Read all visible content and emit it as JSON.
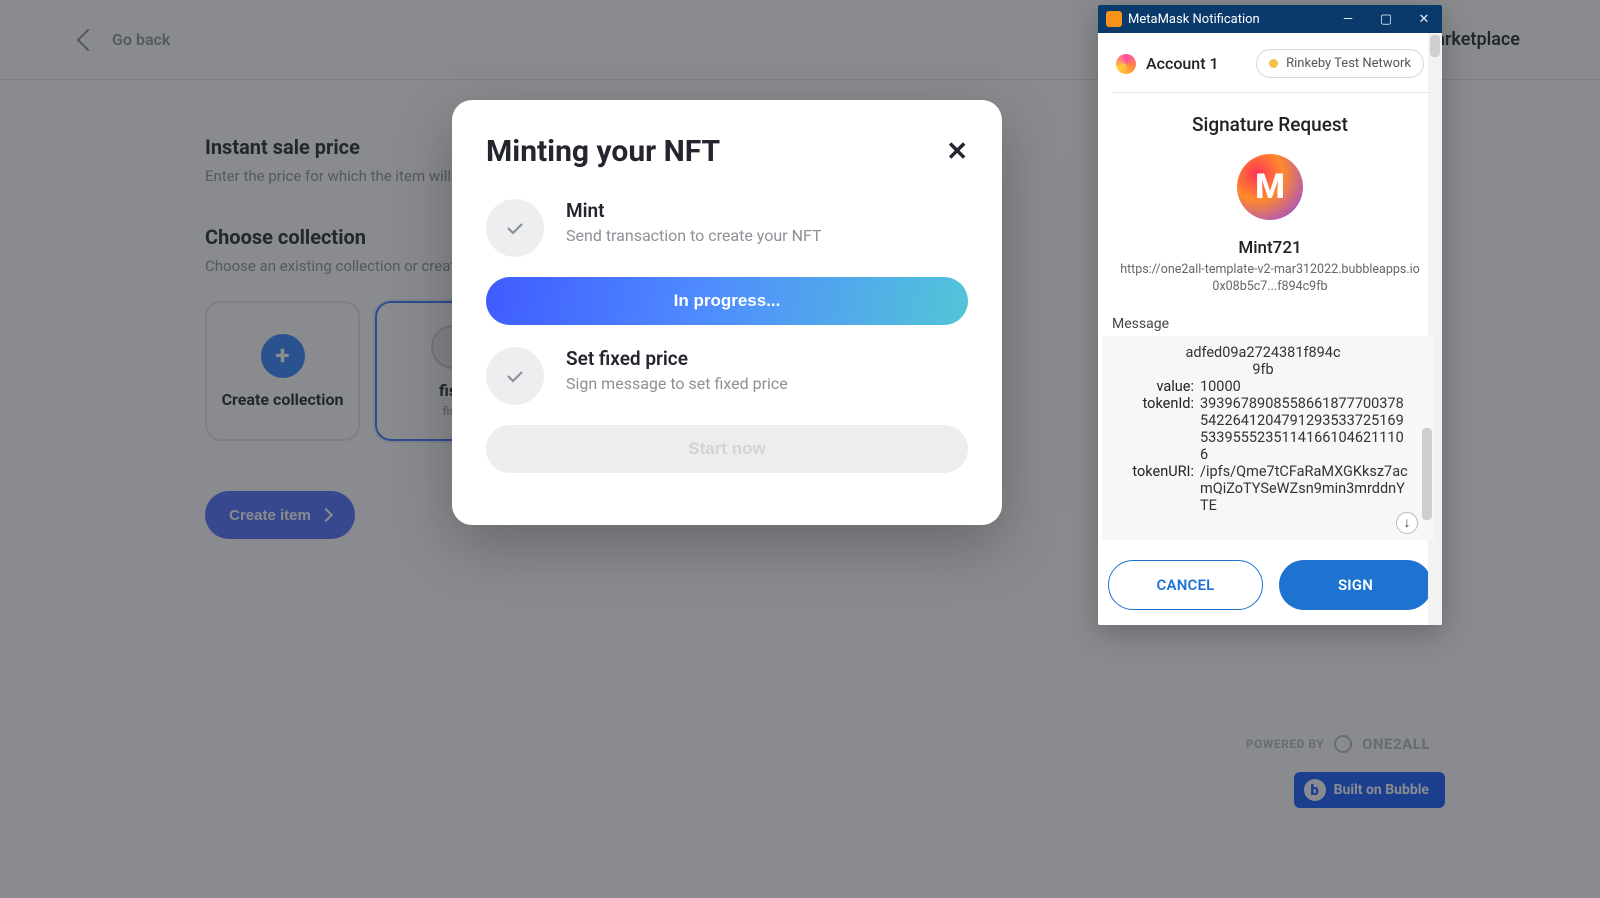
{
  "page": {
    "go_back": "Go back",
    "marketplace": "Marketplace",
    "instant_sale_title": "Instant sale price",
    "instant_sale_sub": "Enter the price for which the item will be in",
    "choose_title": "Choose collection",
    "choose_sub": "Choose an existing collection or create a ne",
    "create_collection": "Create collection",
    "fish_label": "fish",
    "fish_sub": "fish",
    "create_item": "Create item",
    "powered_by": "POWERED BY",
    "brand": "ONE2ALL",
    "bubble_badge": "Built on Bubble"
  },
  "modal": {
    "title": "Minting your NFT",
    "step1_title": "Mint",
    "step1_sub": "Send transaction to create your NFT",
    "progress_btn": "In progress...",
    "step2_title": "Set fixed price",
    "step2_sub": "Sign message to set fixed price",
    "start_btn": "Start now"
  },
  "metamask": {
    "window_title": "MetaMask Notification",
    "account": "Account 1",
    "network": "Rinkeby Test Network",
    "sig_title": "Signature Request",
    "avatar_initial": "M",
    "contract": "Mint721",
    "origin_line1": "https://one2all-template-v2-mar312022.bubbleapps.io",
    "origin_line2": "0x08b5c7...f894c9fb",
    "message_label": "Message",
    "msg_hash_line1": "adfed09a2724381f894c",
    "msg_hash_line2": "9fb",
    "value_label": "value:",
    "value": "10000",
    "tokenId_label": "tokenId:",
    "tokenId": "3939678908558661877700378542264120479129353372516953395552351141661046211106",
    "tokenURI_label": "tokenURI:",
    "tokenURI": "/ipfs/Qme7tCFaRaMXGKksz7acmQiZoTYSeWZsn9min3mrddnYTE",
    "cancel": "Cancel",
    "sign": "Sign"
  }
}
